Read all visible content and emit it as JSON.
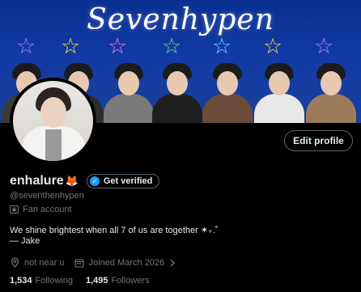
{
  "banner": {
    "title": "Sevenhypen",
    "star_colors": [
      "#b07cff",
      "#f0e04a",
      "#ff7fb8",
      "#5be07a",
      "#6fd8ff",
      "#f3d84a",
      "#c07cff"
    ],
    "member_tops": [
      "#3b3b3b",
      "#2d2d2d",
      "#7a7a7a",
      "#1f1f1f",
      "#6b4b3a",
      "#e8e8e8",
      "#9c7b5a"
    ]
  },
  "profile": {
    "display_name": "enhalure",
    "name_emoji_icon": "fox-face-icon",
    "verify_label": "Get verified",
    "handle": "@seventhenhypen",
    "category": "Fan account",
    "bio_line1": "We shine brightest when all 7 of us are together ✶₊.˚",
    "bio_line2": "— Jake",
    "location": "not near u",
    "joined": "Joined March 2026",
    "following_count": "1,534",
    "following_label": "Following",
    "followers_count": "1,495",
    "followers_label": "Followers"
  },
  "actions": {
    "edit_profile": "Edit profile"
  },
  "colors": {
    "accent": "#1d9bf0",
    "muted": "#71767b",
    "text": "#e7e9ea",
    "border": "#536471"
  }
}
